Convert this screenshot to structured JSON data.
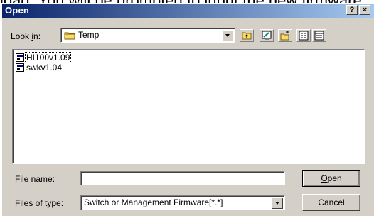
{
  "background_text": "load. You will be prompted to input the new firmware",
  "dialog": {
    "title": "Open",
    "help_button": "?",
    "close_button": "×"
  },
  "look_in": {
    "label_pre": "Look ",
    "label_key": "i",
    "label_post": "n:",
    "value": "Temp"
  },
  "toolbar": {
    "icons": [
      "up-one-level-icon",
      "desktop-icon",
      "create-new-folder-icon",
      "list-view-icon",
      "details-view-icon"
    ]
  },
  "files": [
    {
      "name": "HI100v1.09",
      "selected": true
    },
    {
      "name": "swkv1.04",
      "selected": false
    }
  ],
  "file_name": {
    "label_pre": "File ",
    "label_key": "n",
    "label_post": "ame:",
    "value": ""
  },
  "files_of_type": {
    "label_pre": "Files of ",
    "label_key": "t",
    "label_post": "ype:",
    "value": "Switch or Management Firmware[*.*]"
  },
  "buttons": {
    "open_key": "O",
    "open_rest": "pen",
    "cancel": "Cancel"
  },
  "colors": {
    "title_start": "#0a246a",
    "title_end": "#a6caf0",
    "face": "#d4d0c8"
  }
}
